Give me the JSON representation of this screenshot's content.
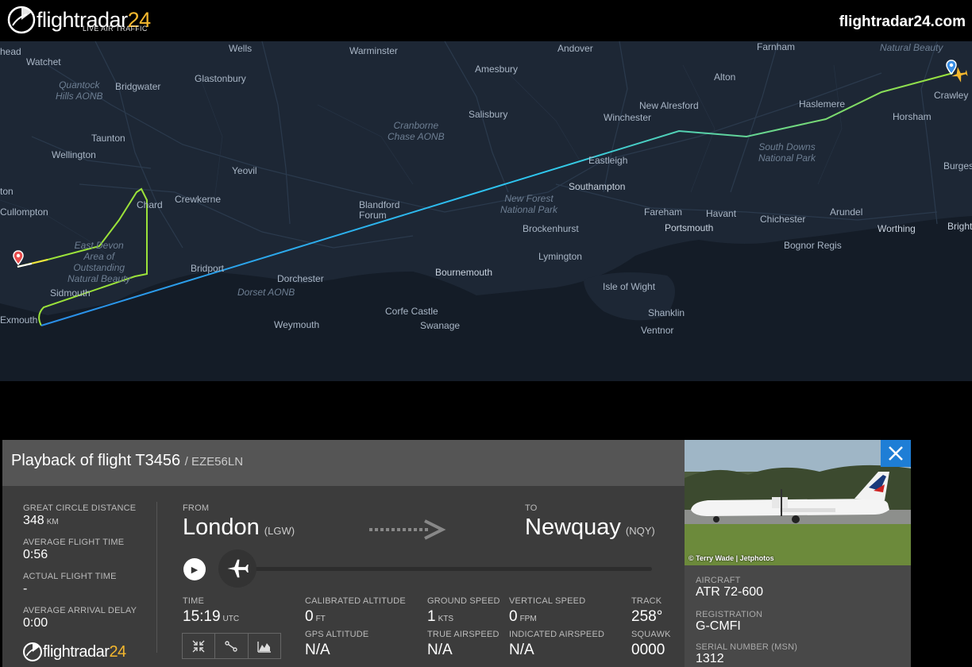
{
  "header": {
    "logo_main": "flightradar",
    "logo_num": "24",
    "logo_tagline": "LIVE AIR TRAFFIC",
    "site_url": "flightradar24.com"
  },
  "map": {
    "places": [
      {
        "name": "head",
        "kind": "town"
      },
      {
        "name": "Watchet",
        "kind": "town"
      },
      {
        "name": "Wells",
        "kind": "town"
      },
      {
        "name": "Warminster",
        "kind": "town"
      },
      {
        "name": "Andover",
        "kind": "town"
      },
      {
        "name": "Farnham",
        "kind": "town"
      },
      {
        "name": "Natural Beauty",
        "kind": "area"
      },
      {
        "name": "Bridgwater",
        "kind": "town"
      },
      {
        "name": "Glastonbury",
        "kind": "town"
      },
      {
        "name": "Amesbury",
        "kind": "town"
      },
      {
        "name": "Alton",
        "kind": "town"
      },
      {
        "name": "Haslemere",
        "kind": "town"
      },
      {
        "name": "Crawley",
        "kind": "town"
      },
      {
        "name": "Quantock\nHills AONB",
        "kind": "area"
      },
      {
        "name": "Taunton",
        "kind": "town"
      },
      {
        "name": "Salisbury",
        "kind": "town"
      },
      {
        "name": "New Alresford",
        "kind": "town"
      },
      {
        "name": "Winchester",
        "kind": "town"
      },
      {
        "name": "Horsham",
        "kind": "town"
      },
      {
        "name": "Cranborne\nChase AONB",
        "kind": "area"
      },
      {
        "name": "Wellington",
        "kind": "town"
      },
      {
        "name": "Yeovil",
        "kind": "town"
      },
      {
        "name": "South Downs\nNational Park",
        "kind": "area"
      },
      {
        "name": "Eastleigh",
        "kind": "town"
      },
      {
        "name": "Burges",
        "kind": "town"
      },
      {
        "name": "Chard",
        "kind": "town"
      },
      {
        "name": "Crewkerne",
        "kind": "town"
      },
      {
        "name": "Southampton",
        "kind": "city"
      },
      {
        "name": "New Forest\nNational Park",
        "kind": "area"
      },
      {
        "name": "Cullompton",
        "kind": "town"
      },
      {
        "name": "Blandford\nForum",
        "kind": "town"
      },
      {
        "name": "Fareham",
        "kind": "town"
      },
      {
        "name": "Havant",
        "kind": "town"
      },
      {
        "name": "Chichester",
        "kind": "town"
      },
      {
        "name": "Arundel",
        "kind": "town"
      },
      {
        "name": "Brockenhurst",
        "kind": "town"
      },
      {
        "name": "Portsmouth",
        "kind": "city"
      },
      {
        "name": "Worthing",
        "kind": "city"
      },
      {
        "name": "Bognor Regis",
        "kind": "town"
      },
      {
        "name": "East Devon\nArea of\nOutstanding\nNatural Beauty",
        "kind": "area"
      },
      {
        "name": "Bridport",
        "kind": "town"
      },
      {
        "name": "Lymington",
        "kind": "town"
      },
      {
        "name": "Dorchester",
        "kind": "town"
      },
      {
        "name": "Bournemouth",
        "kind": "city"
      },
      {
        "name": "Isle of Wight",
        "kind": "town"
      },
      {
        "name": "Sidmouth",
        "kind": "town"
      },
      {
        "name": "Dorset AONB",
        "kind": "area"
      },
      {
        "name": "Exmouth",
        "kind": "town"
      },
      {
        "name": "Corfe Castle",
        "kind": "town"
      },
      {
        "name": "Shanklin",
        "kind": "town"
      },
      {
        "name": "Weymouth",
        "kind": "town"
      },
      {
        "name": "Swanage",
        "kind": "town"
      },
      {
        "name": "Ventnor",
        "kind": "town"
      },
      {
        "name": "ton",
        "kind": "town"
      },
      {
        "name": "Bright",
        "kind": "city"
      }
    ],
    "colors": {
      "track_low": "#2ec8f0",
      "track_mid": "#2a8de8",
      "track_high": "#9be23a",
      "track_end": "#f3e53c",
      "origin_pin": "#e84c4c",
      "dest_pin": "#3a8fe6"
    }
  },
  "panel": {
    "title": "Playback of flight T3456",
    "title_sub": "/ EZE56LN",
    "stats": {
      "gc_distance_label": "GREAT CIRCLE DISTANCE",
      "gc_distance_value": "348",
      "gc_distance_unit": "KM",
      "avg_flight_time_label": "AVERAGE FLIGHT TIME",
      "avg_flight_time_value": "0:56",
      "actual_flight_time_label": "ACTUAL FLIGHT TIME",
      "actual_flight_time_value": "-",
      "avg_arrival_delay_label": "AVERAGE ARRIVAL DELAY",
      "avg_arrival_delay_value": "0:00"
    },
    "from_label": "FROM",
    "from_city": "London",
    "from_code": "(LGW)",
    "to_label": "TO",
    "to_city": "Newquay",
    "to_code": "(NQY)",
    "playback_progress": 0,
    "telemetry": {
      "time_label": "TIME",
      "time_value": "15:19",
      "time_unit": "UTC",
      "cal_alt_label": "CALIBRATED ALTITUDE",
      "cal_alt_value": "0",
      "cal_alt_unit": "FT",
      "gps_alt_label": "GPS ALTITUDE",
      "gps_alt_value": "N/A",
      "ground_speed_label": "GROUND SPEED",
      "ground_speed_value": "1",
      "ground_speed_unit": "KTS",
      "true_airspeed_label": "TRUE AIRSPEED",
      "true_airspeed_value": "N/A",
      "vertical_speed_label": "VERTICAL SPEED",
      "vertical_speed_value": "0",
      "vertical_speed_unit": "FPM",
      "indicated_airspeed_label": "INDICATED AIRSPEED",
      "indicated_airspeed_value": "N/A",
      "track_label": "TRACK",
      "track_value": "258°",
      "squawk_label": "SQUAWK",
      "squawk_value": "0000"
    },
    "tools": [
      "expand-icon",
      "route-icon",
      "chart-icon"
    ]
  },
  "aircraft": {
    "photo_credit": "© Terry Wade | Jetphotos",
    "aircraft_label": "AIRCRAFT",
    "aircraft_value": "ATR 72-600",
    "registration_label": "REGISTRATION",
    "registration_value": "G-CMFI",
    "serial_label": "SERIAL NUMBER (MSN)",
    "serial_value": "1312"
  }
}
